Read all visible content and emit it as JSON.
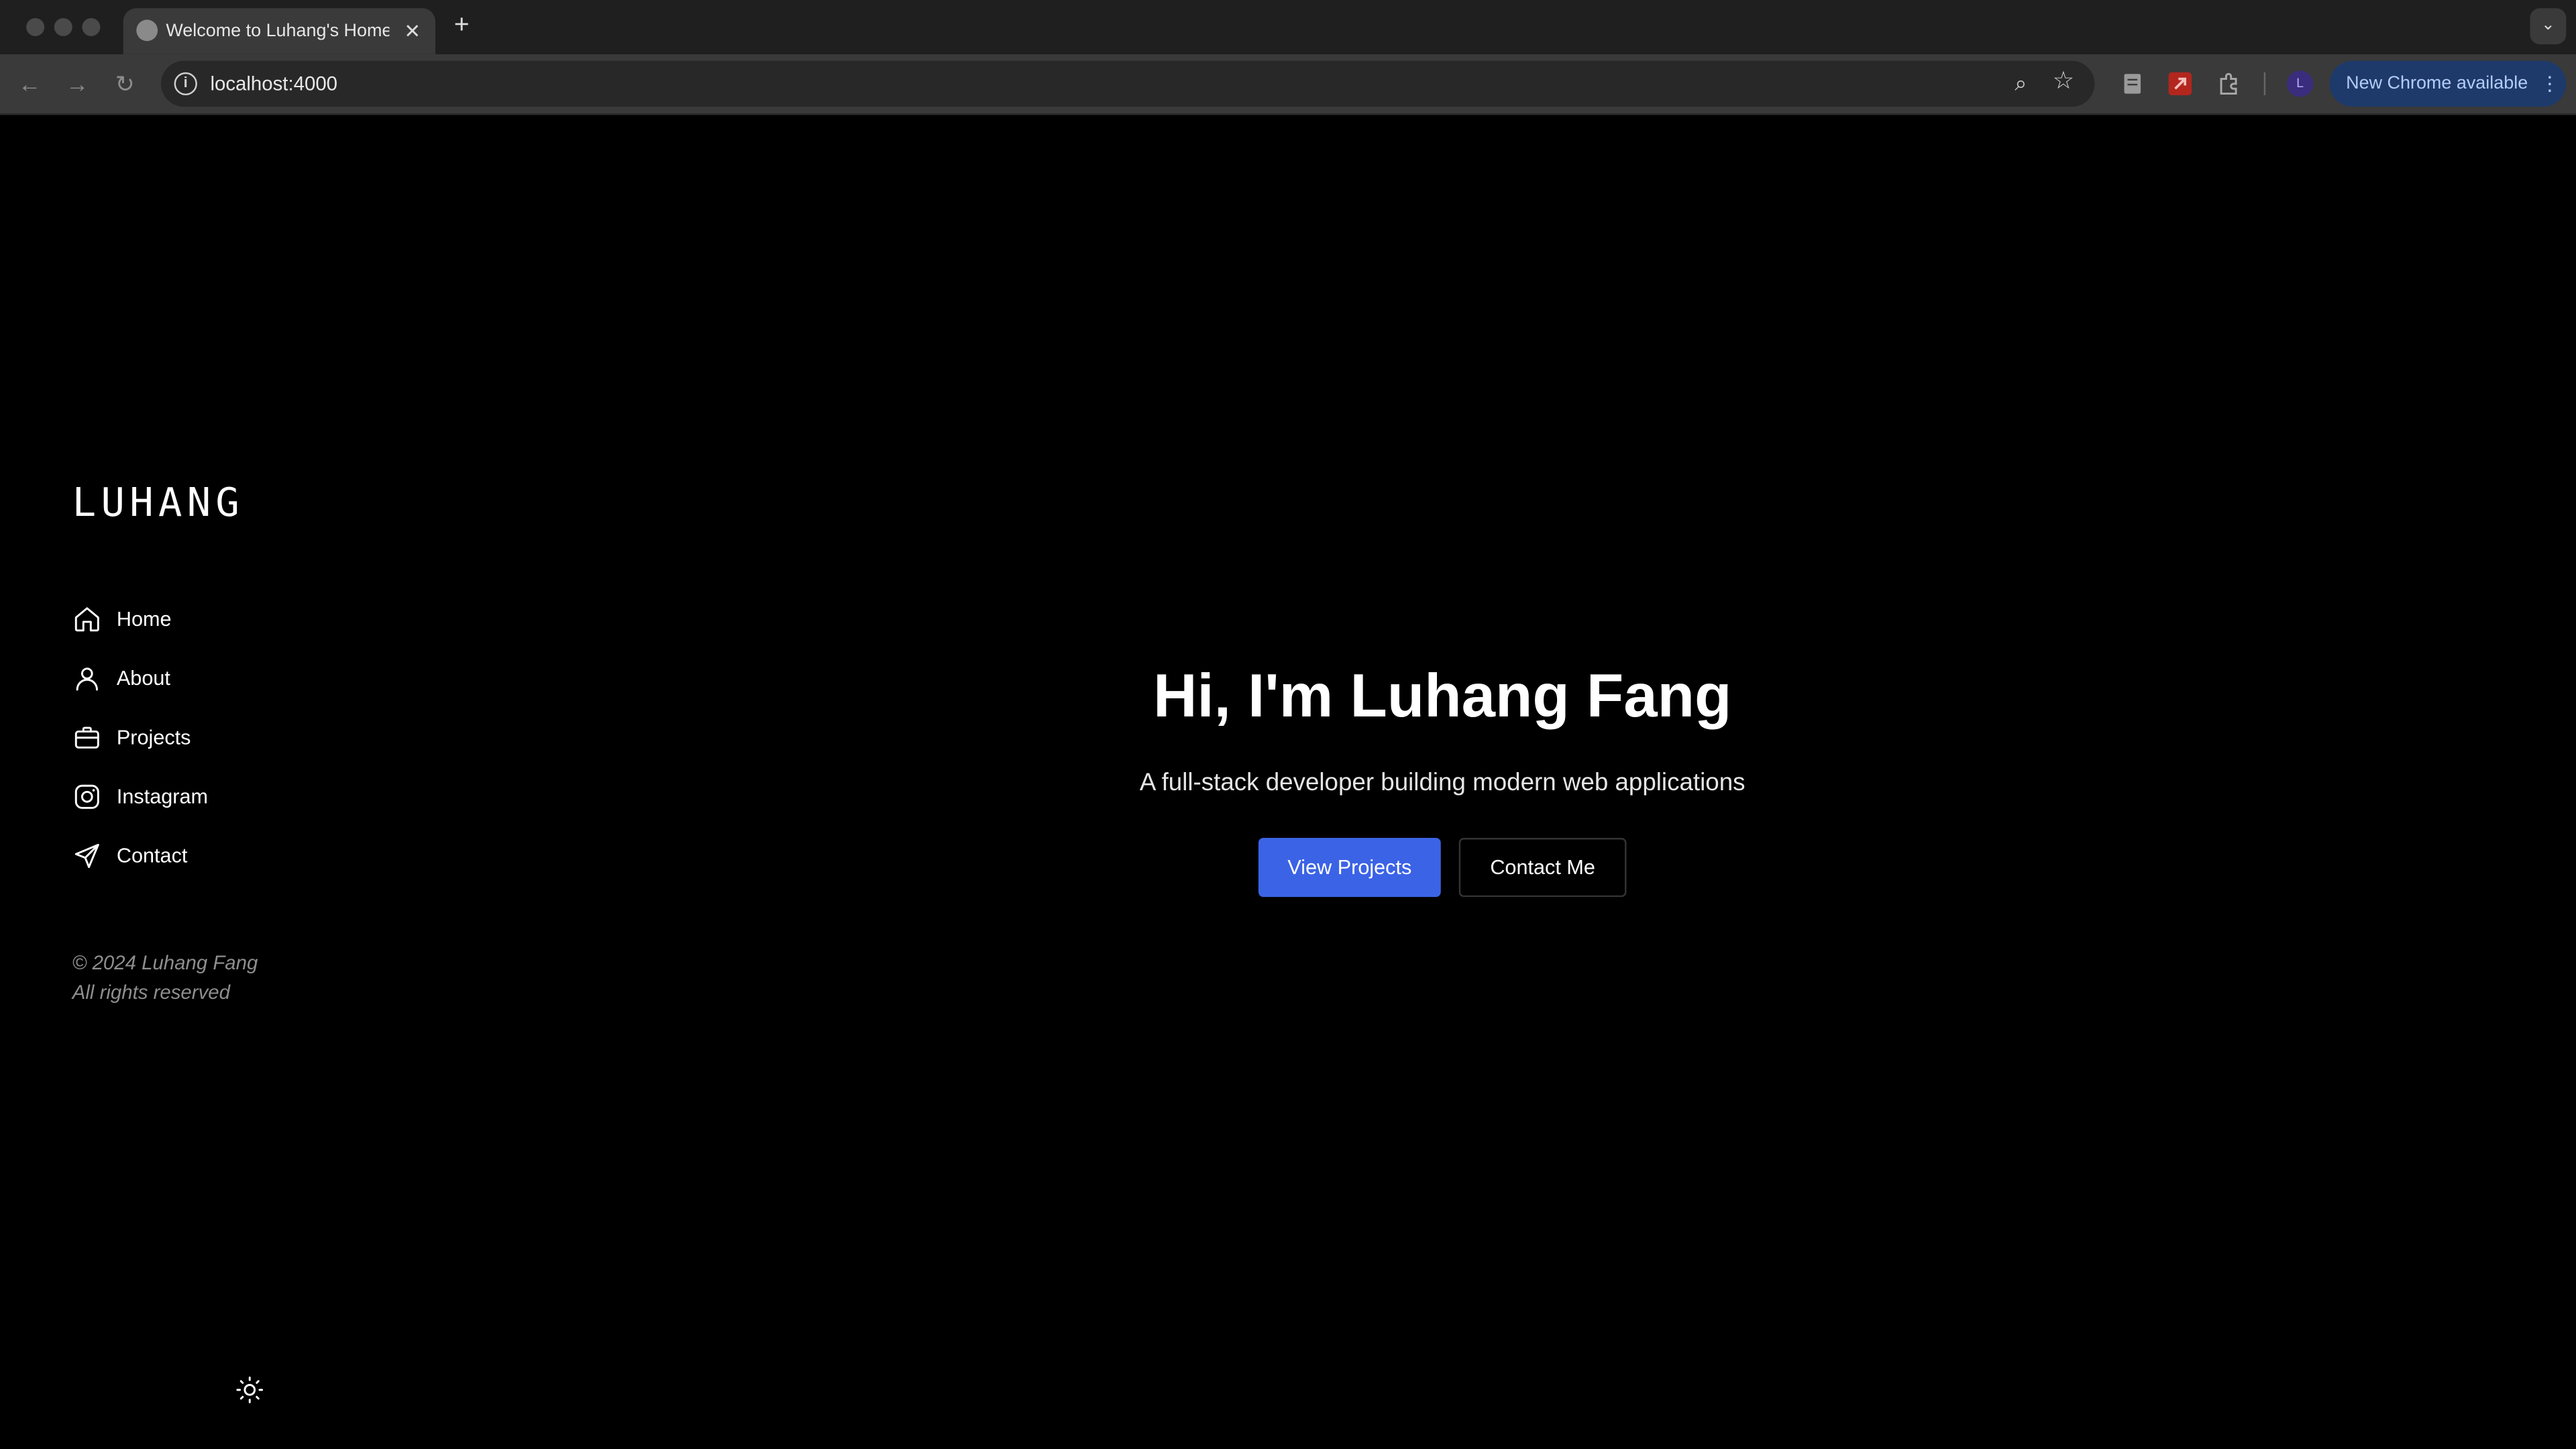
{
  "browser": {
    "tab_title": "Welcome to Luhang's Homepage",
    "tab_close": "✕",
    "new_tab": "+",
    "tab_list": "⌄",
    "back": "←",
    "forward": "→",
    "reload": "↻",
    "site_info": "i",
    "url": "localhost:4000",
    "zoom": "⌕",
    "bookmark": "☆",
    "profile_initial": "L",
    "update_label": "New Chrome available",
    "update_menu": "⋮",
    "colors": {
      "titlebar": "#1f1f1f",
      "toolbar": "#3a3a3a",
      "omnibox": "#282828",
      "update_button": "#1e3a6b",
      "extension_red": "#b3261e"
    }
  },
  "sidebar": {
    "logo": "LUHANG",
    "nav": [
      {
        "label": "Home",
        "icon": "home-icon"
      },
      {
        "label": "About",
        "icon": "user-icon"
      },
      {
        "label": "Projects",
        "icon": "briefcase-icon"
      },
      {
        "label": "Instagram",
        "icon": "instagram-icon"
      },
      {
        "label": "Contact",
        "icon": "send-icon"
      }
    ],
    "copyright_line1": "© 2024 Luhang Fang",
    "copyright_line2": "All rights reserved",
    "theme_toggle_icon": "sun-icon"
  },
  "hero": {
    "title": "Hi, I'm Luhang Fang",
    "subtitle": "A full-stack developer building modern web applications",
    "primary_button": "View Projects",
    "secondary_button": "Contact Me",
    "accent_color": "#3b63e6"
  }
}
